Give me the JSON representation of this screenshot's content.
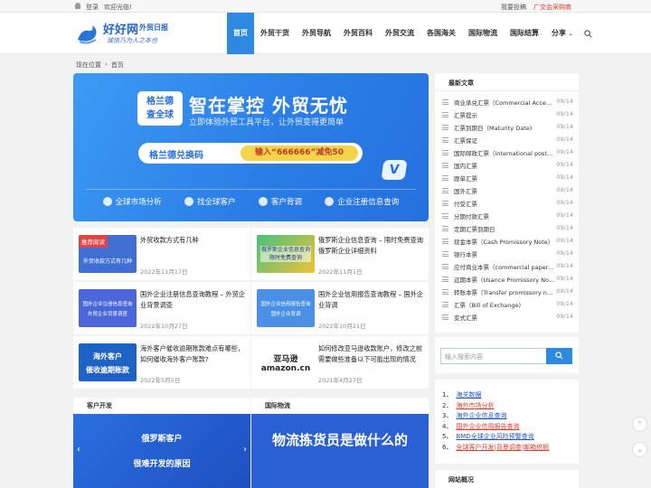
{
  "topbar": {
    "login": "登录",
    "welcome": "欢迎光临!",
    "contribute": "我要投稿",
    "purchase": "广交会采购商"
  },
  "logo": {
    "name": "好好网",
    "tag": "外贸日报",
    "slogan": "诚信乃为人之本也"
  },
  "nav": [
    "首页",
    "外贸干货",
    "外贸导航",
    "外贸百科",
    "外贸交流",
    "各国海关",
    "国际物流",
    "国际结算",
    "分享"
  ],
  "breadcrumb": {
    "prefix": "现在位置",
    "current": "首页"
  },
  "banner": {
    "badge_line1": "格兰德",
    "badge_line2": "查全球",
    "title": "智在掌控 外贸无忧",
    "subtitle": "立即体验外贸工具平台，让外贸变得更简单",
    "code_label": "格兰德兑换码",
    "code_value": "输入“666666”减免50",
    "links": [
      "全球市场分析",
      "找全球客户",
      "客户背调",
      "企业注册信息查询"
    ]
  },
  "articles": [
    {
      "thumb": "外贸收款方式有几种",
      "badge": "推荐阅读",
      "title": "外贸收款方式有几种",
      "date": "2022年11月17日"
    },
    {
      "thumb": "俄罗斯企业信息查询 限时免费查询",
      "title": "俄罗斯企业信息查询 – 限时免费查询俄罗斯企业详细资料",
      "date": "2022年11月1日"
    },
    {
      "thumb": "国外企业注册信息查询 外贸企业背景调查",
      "title": "国外企业注册信息查询教程 – 外贸企业背景调查",
      "date": "2022年10月27日"
    },
    {
      "thumb": "国外企业信用报告查询 国外企业背调",
      "title": "国外企业信用报告查询教程 – 国外企业背调",
      "date": "2022年10月21日"
    },
    {
      "thumb_line1": "海外客户",
      "thumb_line2": "催收逾期账款",
      "title": "海外客户催收逾期账款难点有哪些，如何催收海外客户账款?",
      "date": "2022年5月5日"
    },
    {
      "thumb_line1": "亚马逊",
      "thumb_line2": "amazon.cn",
      "title": "如何修改亚马逊收款账户，修改之前需要做些准备以下可能出现的情况",
      "date": "2021年4月27日"
    }
  ],
  "sections": [
    {
      "title": "客户开发",
      "img_line1": "俄罗斯客户",
      "img_line2": "很难开发的原因"
    },
    {
      "title": "国际物流",
      "img_text": "物流拣货员是做什么的"
    }
  ],
  "sidebar": {
    "latest_title": "最新文章",
    "latest": [
      {
        "title": "商业承兑汇票（Commercial Acceptance Bill）",
        "date": "09/14"
      },
      {
        "title": "汇票提示",
        "date": "09/14"
      },
      {
        "title": "汇票到期日（Maturity Date)",
        "date": "09/14"
      },
      {
        "title": "汇票保证",
        "date": "09/14"
      },
      {
        "title": "国际邮政汇票（international postal money order）",
        "date": "09/14"
      },
      {
        "title": "国内汇票",
        "date": "09/14"
      },
      {
        "title": "跟单汇票",
        "date": "09/14"
      },
      {
        "title": "国外汇票",
        "date": "09/14"
      },
      {
        "title": "付受汇票",
        "date": "09/14"
      },
      {
        "title": "分期付款汇票",
        "date": "09/14"
      },
      {
        "title": "定期汇票到期日",
        "date": "09/14"
      },
      {
        "title": "现金本票（Cash Promissory Note）",
        "date": "09/14"
      },
      {
        "title": "银行本票",
        "date": "09/14"
      },
      {
        "title": "应付商业本票（commercial paper payable）",
        "date": "09/14"
      },
      {
        "title": "远期本票（Usance Promissory Note）",
        "date": "09/14"
      },
      {
        "title": "转账本票（Transfer promissory note）",
        "date": "09/14"
      },
      {
        "title": "汇票（Bill of Exchange)",
        "date": "09/14"
      },
      {
        "title": "变式汇票",
        "date": "09/14"
      }
    ],
    "search_placeholder": "输入搜索内容",
    "links": [
      {
        "n": "1、",
        "t": "海关数据",
        "color": "#2255cc"
      },
      {
        "n": "2、",
        "t": "海外市场分析",
        "color": "#e23a2f"
      },
      {
        "n": "3、",
        "t": "海外企业信息查询",
        "color": "#2255cc"
      },
      {
        "n": "4、",
        "t": "国外企业信用报告查询",
        "color": "#e23a2f"
      },
      {
        "n": "5、",
        "t": "BMD全球企业风险预警查询",
        "color": "#2255cc"
      },
      {
        "n": "6、",
        "t": "全球客户开发|背景调查|邮箱挖掘",
        "color": "#e23a2f"
      }
    ],
    "overview_title": "网站概况"
  }
}
